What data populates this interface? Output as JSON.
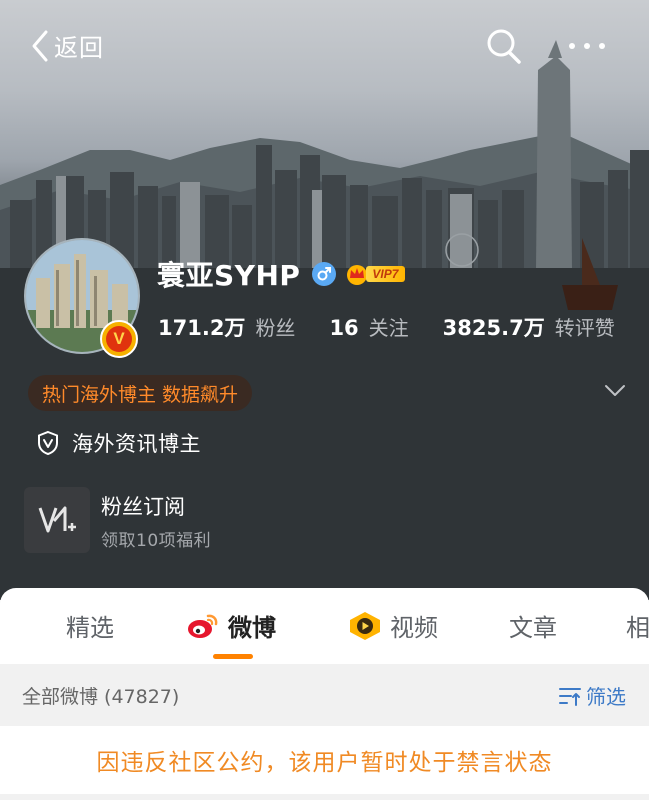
{
  "header": {
    "back_label": "返回",
    "icons": [
      "chevron-left-icon",
      "search-icon",
      "more-icon"
    ]
  },
  "profile": {
    "name": "寰亚SYHP",
    "vip_label": "VIP7",
    "verified_badge": "V",
    "stats": [
      {
        "value": "171.2万",
        "label": "粉丝"
      },
      {
        "value": "16",
        "label": "关注"
      },
      {
        "value": "3825.7万",
        "label": "转评赞"
      }
    ],
    "hot_tag": "热门海外博主 数据飙升",
    "verification": "海外资讯博主",
    "subscription": {
      "title": "粉丝订阅",
      "description": "领取10项福利"
    }
  },
  "tabs": [
    {
      "label": "精选",
      "active": false
    },
    {
      "label": "微博",
      "active": true
    },
    {
      "label": "视频",
      "active": false
    },
    {
      "label": "文章",
      "active": false
    },
    {
      "label": "相",
      "active": false
    }
  ],
  "feed": {
    "all_label": "全部微博 (47827)",
    "filter_label": "筛选"
  },
  "notice": "因违反社区公约，该用户暂时处于禁言状态",
  "colors": {
    "accent": "#ff8200",
    "notice": "#f08a24",
    "filter": "#3d7ac7",
    "hot_tag": "#ff8a2a"
  }
}
